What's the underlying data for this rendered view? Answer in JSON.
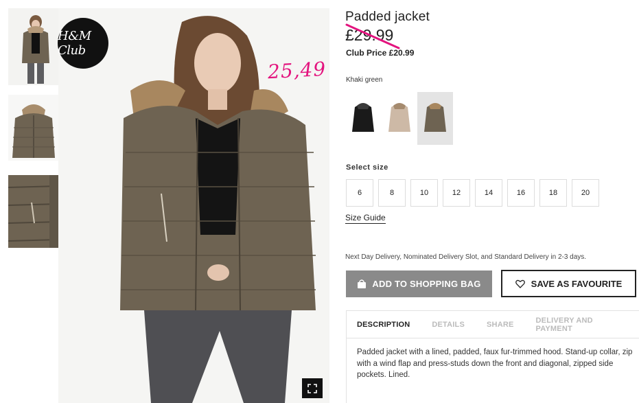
{
  "badge": {
    "text": "H&M Club"
  },
  "annotation": {
    "price": "25,49",
    "color": "#e3137e"
  },
  "product": {
    "title": "Padded jacket",
    "old_price": "£29.99",
    "club_price": "Club Price £20.99",
    "color_name": "Khaki green"
  },
  "sizes": {
    "label": "Select size",
    "options": [
      "6",
      "8",
      "10",
      "12",
      "14",
      "16",
      "18",
      "20"
    ],
    "guide": "Size Guide"
  },
  "delivery": "Next Day Delivery, Nominated Delivery Slot, and Standard Delivery in 2-3 days.",
  "actions": {
    "add_to_bag": "ADD TO SHOPPING BAG",
    "save_favourite": "SAVE AS FAVOURITE"
  },
  "tabs": [
    "DESCRIPTION",
    "DETAILS",
    "SHARE",
    "DELIVERY AND PAYMENT"
  ],
  "description": "Padded jacket with a lined, padded, faux fur-trimmed hood. Stand-up collar, zip with a wind flap and press-studs down the front and diagonal, zipped side pockets. Lined.",
  "colors": {
    "button_grey": "#8a8a8a",
    "jacket_khaki": "#6e6352",
    "badge_black": "#111111"
  },
  "icons": [
    "expand-icon",
    "bag-icon",
    "heart-icon"
  ]
}
